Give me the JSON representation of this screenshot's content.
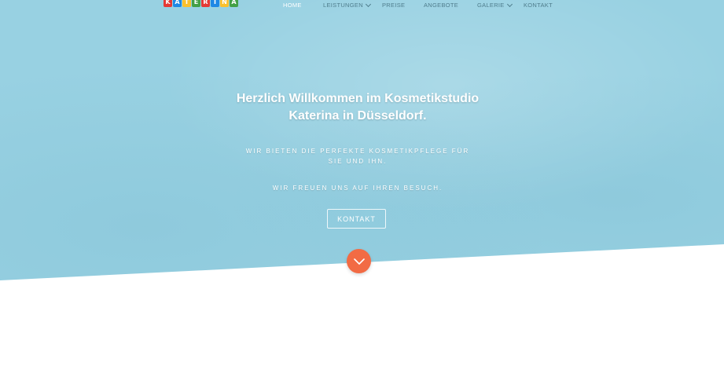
{
  "brand": {
    "logo_letters": [
      "K",
      "A",
      "T",
      "E",
      "R",
      "I",
      "N",
      "A"
    ],
    "logo_colors": [
      "#e53935",
      "#1e88e5",
      "#fbc02d",
      "#43a047",
      "#e53935",
      "#1e88e5",
      "#fbc02d",
      "#43a047"
    ]
  },
  "nav": {
    "items": [
      {
        "label": "HOME",
        "active": true,
        "has_submenu": false
      },
      {
        "label": "LEISTUNGEN",
        "active": false,
        "has_submenu": true
      },
      {
        "label": "PREISE",
        "active": false,
        "has_submenu": false
      },
      {
        "label": "ANGEBOTE",
        "active": false,
        "has_submenu": false
      },
      {
        "label": "GALERIE",
        "active": false,
        "has_submenu": true
      },
      {
        "label": "KONTAKT",
        "active": false,
        "has_submenu": false
      }
    ]
  },
  "hero": {
    "headline_line1": "Herzlich Willkommen im Kosmetikstudio",
    "headline_line2": "Katerina in Düsseldorf.",
    "tagline_line1": "WIR BIETEN DIE PERFEKTE KOSMETIKPFLEGE FÜR",
    "tagline_line2": "SIE UND IHN.",
    "tagline2": "WIR FREUEN UNS AUF IHREN BESUCH.",
    "cta_label": "KONTAKT",
    "scroll_icon": "chevron-down-icon"
  },
  "colors": {
    "hero_bg": "#98d1e2",
    "accent": "#f26b44",
    "nav_text": "#4f7d8c",
    "nav_active": "#ffffff"
  }
}
